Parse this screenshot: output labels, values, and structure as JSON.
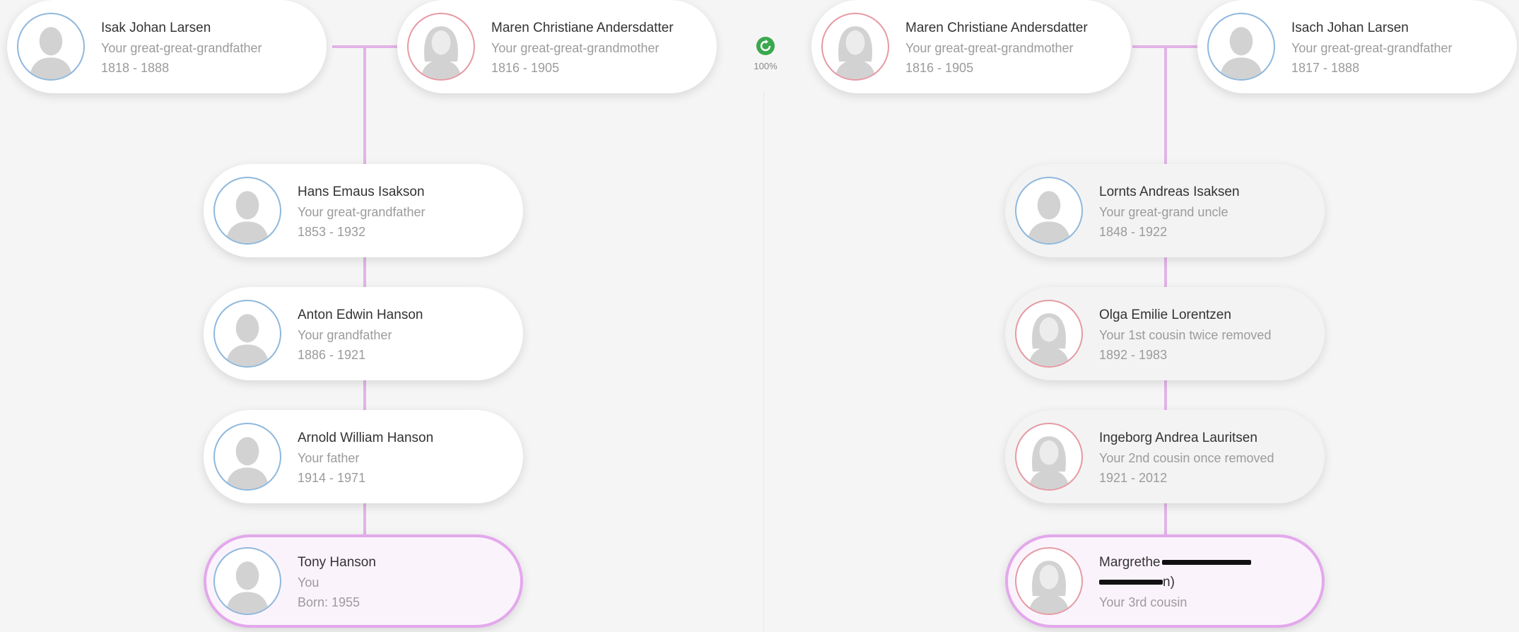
{
  "progress": {
    "percent_label": "100%",
    "icon": "refresh-icon",
    "color": "#3ba84f"
  },
  "left_branch": {
    "ancestor_father": {
      "name": "Isak Johan Larsen",
      "relation": "Your great-great-grandfather",
      "years": "1818 - 1888",
      "gender": "male"
    },
    "ancestor_mother": {
      "name": "Maren Christiane Andersdatter",
      "relation": "Your great-great-grandmother",
      "years": "1816 - 1905",
      "gender": "female"
    },
    "people": [
      {
        "name": "Hans Emaus Isakson",
        "relation": "Your great-grandfather",
        "years": "1853 - 1932",
        "gender": "male"
      },
      {
        "name": "Anton Edwin Hanson",
        "relation": "Your grandfather",
        "years": "1886 - 1921",
        "gender": "male"
      },
      {
        "name": "Arnold William Hanson",
        "relation": "Your father",
        "years": "1914 - 1971",
        "gender": "male"
      },
      {
        "name": "Tony Hanson",
        "relation": "You",
        "years": "Born: 1955",
        "gender": "male"
      }
    ]
  },
  "right_branch": {
    "ancestor_mother": {
      "name": "Maren Christiane Andersdatter",
      "relation": "Your great-great-grandmother",
      "years": "1816 - 1905",
      "gender": "female"
    },
    "ancestor_father": {
      "name": "Isach Johan Larsen",
      "relation": "Your great-great-grandfather",
      "years": "1817 - 1888",
      "gender": "male"
    },
    "people": [
      {
        "name": "Lornts Andreas Isaksen",
        "relation": "Your great-grand uncle",
        "years": "1848 - 1922",
        "gender": "male"
      },
      {
        "name": "Olga Emilie Lorentzen",
        "relation": "Your 1st cousin twice removed",
        "years": "1892 - 1983",
        "gender": "female"
      },
      {
        "name": "Ingeborg Andrea Lauritsen",
        "relation": "Your 2nd cousin once removed",
        "years": "1921 - 2012",
        "gender": "female"
      },
      {
        "name_visible_start": "Margrethe",
        "name_visible_end": "n)",
        "relation": "Your 3rd cousin",
        "gender": "female"
      }
    ]
  },
  "colors": {
    "connector": "#e2b3e8",
    "male_ring": "#8fb8dd",
    "female_ring": "#e59aa4",
    "you_border": "#e3a8ec"
  }
}
